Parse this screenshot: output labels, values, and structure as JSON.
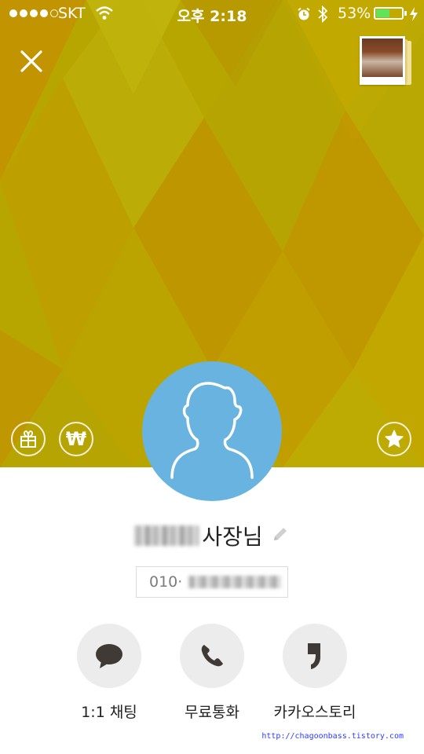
{
  "status_bar": {
    "carrier": "SKT",
    "time": "오후 2:18",
    "battery_percent_text": "53%",
    "battery_level": 0.53
  },
  "cover": {
    "colors": {
      "base": "#b8a600",
      "mustard": "#c29100",
      "olive": "#a99c06",
      "lime": "#c2b60e"
    }
  },
  "profile": {
    "name_suffix": "사장님",
    "phone_prefix": "010·",
    "avatar_color": "#68b3df"
  },
  "actions": [
    {
      "label": "1:1 채팅",
      "icon": "chat-bubble-icon"
    },
    {
      "label": "무료통화",
      "icon": "phone-icon"
    },
    {
      "label": "카카오스토리",
      "icon": "quote-icon"
    }
  ],
  "watermark": "http://chagoonbass.tistory.com",
  "icons": {
    "close": "close-icon",
    "gift": "gift-icon",
    "pay": "won-icon",
    "pay_symbol": "₩",
    "favorite": "star-icon",
    "edit": "pencil-icon"
  }
}
